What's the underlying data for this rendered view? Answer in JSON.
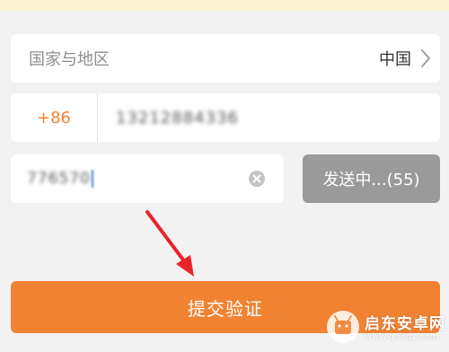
{
  "region": {
    "label": "国家与地区",
    "value": "中国",
    "chevron_icon": "chevron-right-icon"
  },
  "phone": {
    "country_code": "+86",
    "number_blurred": "13212884336"
  },
  "verification": {
    "code_blurred": "776570",
    "clear_icon": "clear-circle-icon",
    "send_label": "发送中...(55)"
  },
  "submit": {
    "label": "提交验证"
  },
  "annotation": {
    "arrow_icon": "red-arrow-icon",
    "arrow_color": "#e8242b"
  },
  "watermark": {
    "title": "启东安卓网",
    "url": "www.qdltdz.com",
    "logo_icon": "watermark-logo-icon"
  },
  "colors": {
    "accent": "#f08232",
    "send_disabled": "#9a9a9a",
    "background": "#f2f2f2",
    "top_banner": "#fbf3d3"
  }
}
